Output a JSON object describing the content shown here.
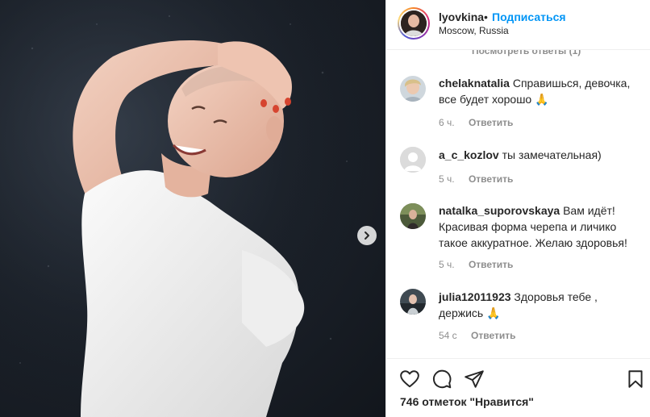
{
  "post": {
    "username": "lyovkina",
    "separator": "•",
    "follow_label": "Подписаться",
    "location": "Moscow, Russia",
    "avatar_icon": "profile-photo"
  },
  "comments": {
    "view_replies_label": "Посмотреть ответы (1)",
    "reply_label": "Ответить",
    "items": [
      {
        "username": "chelaknatalia",
        "text": "Справишься, девочка, все будет хорошо",
        "emoji": "🙏",
        "time": "6 ч."
      },
      {
        "username": "a_c_kozlov",
        "text": "ты замечательная)",
        "emoji": "",
        "time": "5 ч."
      },
      {
        "username": "natalka_suporovskaya",
        "text": "Вам идёт! Красивая форма черепа и личико такое аккуратное. Желаю здоровья!",
        "emoji": "",
        "time": "5 ч."
      },
      {
        "username": "julia12011923",
        "text": "Здоровья тебе , держись",
        "emoji": "🙏",
        "time": "54 с"
      }
    ]
  },
  "actions": {
    "like_icon": "heart-icon",
    "comment_icon": "comment-icon",
    "share_icon": "share-icon",
    "save_icon": "bookmark-icon",
    "likes_text": "746 отметок \"Нравится\""
  },
  "colors": {
    "link": "#0095f6",
    "secondary_text": "#8e8e8e",
    "border": "#efefef"
  }
}
